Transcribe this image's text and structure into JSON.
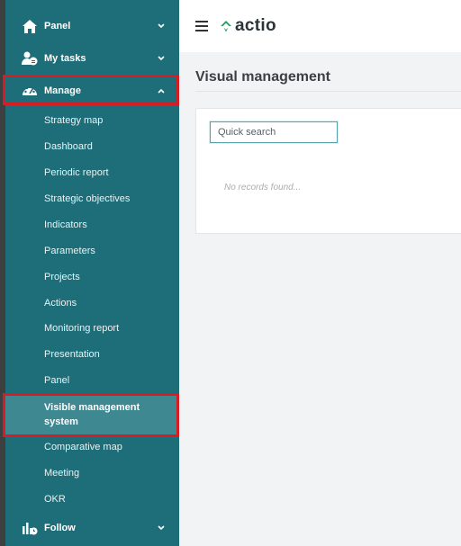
{
  "app": {
    "brand": "actio"
  },
  "colors": {
    "sidebar": "#1e6e79",
    "sidebar_active": "#3e8892",
    "highlight": "#d71d24",
    "logo_green": "#2d9a6a"
  },
  "sidebar": {
    "panel": {
      "label": "Panel",
      "icon": "home-icon",
      "expanded": false
    },
    "my_tasks": {
      "label": "My tasks",
      "icon": "user-tasks-icon",
      "expanded": false
    },
    "manage": {
      "label": "Manage",
      "icon": "dashboard-gauge-icon",
      "expanded": true,
      "items": [
        {
          "label": "Strategy map"
        },
        {
          "label": "Dashboard"
        },
        {
          "label": "Periodic report"
        },
        {
          "label": "Strategic objectives"
        },
        {
          "label": "Indicators"
        },
        {
          "label": "Parameters"
        },
        {
          "label": "Projects"
        },
        {
          "label": "Actions"
        },
        {
          "label": "Monitoring report"
        },
        {
          "label": "Presentation"
        },
        {
          "label": "Panel"
        },
        {
          "label": "Visible management\nsystem",
          "active": true
        },
        {
          "label": "Comparative map"
        },
        {
          "label": "Meeting"
        },
        {
          "label": "OKR"
        }
      ]
    },
    "follow": {
      "label": "Follow",
      "icon": "follow-chart-icon",
      "expanded": false
    }
  },
  "header": {
    "menu_icon": "hamburger-menu-icon"
  },
  "main": {
    "title": "Visual management",
    "search": {
      "placeholder": "Quick search",
      "value": ""
    },
    "empty_message": "No records found..."
  }
}
